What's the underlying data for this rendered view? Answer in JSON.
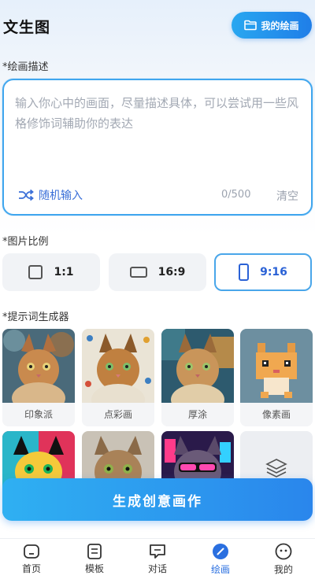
{
  "header": {
    "title": "文生图",
    "my_drawings": "我的绘画"
  },
  "prompt": {
    "section_label": "*绘画描述",
    "placeholder": "输入你心中的画面，尽量描述具体，可以尝试用一些风格修饰词辅助你的表达",
    "value": "",
    "random_label": "随机输入",
    "counter": "0/500",
    "clear_label": "清空"
  },
  "ratio": {
    "section_label": "*图片比例",
    "options": [
      {
        "label": "1:1"
      },
      {
        "label": "16:9"
      },
      {
        "label": "9:16"
      }
    ],
    "selected": "9:16"
  },
  "styles": {
    "section_label": "*提示词生成器",
    "items": [
      {
        "label": "印象派"
      },
      {
        "label": "点彩画"
      },
      {
        "label": "厚涂"
      },
      {
        "label": "像素画"
      }
    ]
  },
  "generate_label": "生成创意画作",
  "tabs": [
    {
      "label": "首页",
      "icon": "home-icon"
    },
    {
      "label": "模板",
      "icon": "template-icon"
    },
    {
      "label": "对话",
      "icon": "chat-icon"
    },
    {
      "label": "绘画",
      "icon": "paint-icon"
    },
    {
      "label": "我的",
      "icon": "profile-icon"
    }
  ],
  "colors": {
    "accent": "#2a86ec",
    "active_tab": "#2a6fe0",
    "border": "#40a6ee"
  }
}
